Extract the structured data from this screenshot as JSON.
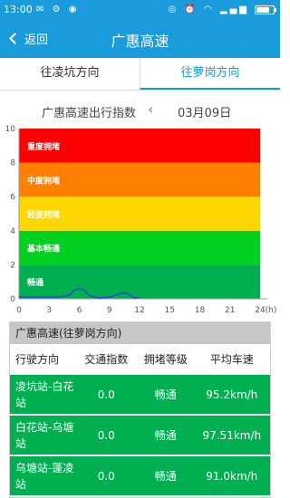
{
  "status": {
    "time": "13:00",
    "battery_level": 0.75
  },
  "header": {
    "back_label": "返回",
    "title": "广惠高速"
  },
  "tabs": [
    {
      "label": "往凌坑方向",
      "active": false
    },
    {
      "label": "往萝岗方向",
      "active": true
    }
  ],
  "chart_header": {
    "title": "广惠高速出行指数",
    "date": "03月09日"
  },
  "chart_data": {
    "type": "line",
    "xlabel": "(h)",
    "ylabel": "",
    "xlim": [
      0,
      24
    ],
    "ylim": [
      0,
      10
    ],
    "xticks": [
      0,
      3,
      6,
      9,
      12,
      15,
      18,
      21,
      24
    ],
    "yticks": [
      0,
      2,
      4,
      6,
      8,
      10
    ],
    "bands": [
      {
        "label": "畅通",
        "from": 0,
        "to": 2,
        "color": "#00b050"
      },
      {
        "label": "基本畅通",
        "from": 2,
        "to": 4,
        "color": "#00d020"
      },
      {
        "label": "轻度拥堵",
        "from": 4,
        "to": 6,
        "color": "#ffd700"
      },
      {
        "label": "中度拥堵",
        "from": 6,
        "to": 8,
        "color": "#ff7f00"
      },
      {
        "label": "重度拥堵",
        "from": 8,
        "to": 10,
        "color": "#ff0000"
      }
    ],
    "series": [
      {
        "color": "#1a4dd6",
        "x": [
          0,
          1,
          2,
          3,
          4,
          5,
          5.5,
          6,
          6.5,
          7,
          7.5,
          8,
          9,
          10,
          10.5,
          11,
          11.5,
          12
        ],
        "y": [
          0.1,
          0.1,
          0.1,
          0.1,
          0.1,
          0.2,
          0.5,
          0.6,
          0.5,
          0.2,
          0.1,
          0.05,
          0.1,
          0.3,
          0.35,
          0.25,
          0.05,
          0.1
        ]
      }
    ]
  },
  "table": {
    "title": "广惠高速(往萝岗方向)",
    "columns": [
      "行驶方向",
      "交通指数",
      "拥堵等级",
      "平均车速"
    ],
    "rows": [
      {
        "segment": "凌坑站-白花站",
        "index": "0.0",
        "level": "畅通",
        "speed": "95.2km/h"
      },
      {
        "segment": "白花站-乌塘站",
        "index": "0.0",
        "level": "畅通",
        "speed": "97.51km/h"
      },
      {
        "segment": "乌塘站-蓬凌站",
        "index": "0.0",
        "level": "畅通",
        "speed": "91.0km/h"
      }
    ]
  }
}
